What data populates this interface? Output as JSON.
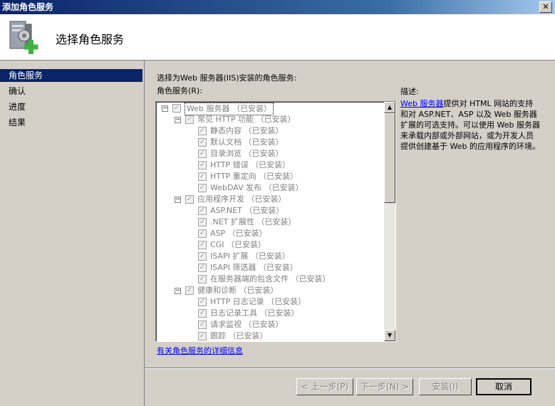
{
  "window": {
    "title": "添加角色服务",
    "close_glyph": "✕"
  },
  "header": {
    "title": "选择角色服务"
  },
  "sidebar": {
    "items": [
      "角色服务",
      "确认",
      "进度",
      "结果"
    ],
    "active_index": 0
  },
  "main": {
    "instruction": "选择为Web 服务器(IIS)安装的角色服务:",
    "list_label": "角色服务(R):",
    "tree": [
      {
        "level": 0,
        "expander": "⊟",
        "label": "Web 服务器 （已安装）",
        "selected": true
      },
      {
        "level": 1,
        "expander": "⊟",
        "label": "常见 HTTP 功能 （已安装）"
      },
      {
        "level": 2,
        "label": "静态内容 （已安装）"
      },
      {
        "level": 2,
        "label": "默认文档 （已安装）"
      },
      {
        "level": 2,
        "label": "目录浏览 （已安装）"
      },
      {
        "level": 2,
        "label": "HTTP 错误 （已安装）"
      },
      {
        "level": 2,
        "label": "HTTP 重定向 （已安装）"
      },
      {
        "level": 2,
        "label": "WebDAV 发布 （已安装）"
      },
      {
        "level": 1,
        "expander": "⊟",
        "label": "应用程序开发 （已安装）"
      },
      {
        "level": 2,
        "label": "ASP.NET （已安装）"
      },
      {
        "level": 2,
        "label": ".NET 扩展性 （已安装）"
      },
      {
        "level": 2,
        "label": "ASP （已安装）"
      },
      {
        "level": 2,
        "label": "CGI （已安装）"
      },
      {
        "level": 2,
        "label": "ISAPI 扩展 （已安装）"
      },
      {
        "level": 2,
        "label": "ISAPI 筛选器 （已安装）"
      },
      {
        "level": 2,
        "label": "在服务器端的包含文件 （已安装）"
      },
      {
        "level": 1,
        "expander": "⊟",
        "label": "健康和诊断 （已安装）"
      },
      {
        "level": 2,
        "label": "HTTP 日志记录 （已安装）"
      },
      {
        "level": 2,
        "label": "日志记录工具 （已安装）"
      },
      {
        "level": 2,
        "label": "请求监视 （已安装）"
      },
      {
        "level": 2,
        "label": "跟踪 （已安装）"
      }
    ],
    "more_info_link": "有关角色服务的详细信息",
    "scroll_up_glyph": "▲",
    "scroll_down_glyph": "▼"
  },
  "description": {
    "title": "描述:",
    "link": "Web 服务器",
    "text": "提供对 HTML 网站的支持和对 ASP.NET、ASP 以及 Web 服务器扩展的可选支持。可以使用 Web 服务器来承载内部或外部网站，或为开发人员提供创建基于 Web 的应用程序的环境。"
  },
  "buttons": {
    "prev": "< 上一步(P)",
    "next": "下一步(N) >",
    "install": "安装(I)",
    "cancel": "取消"
  },
  "checkbox_glyph": "✓"
}
